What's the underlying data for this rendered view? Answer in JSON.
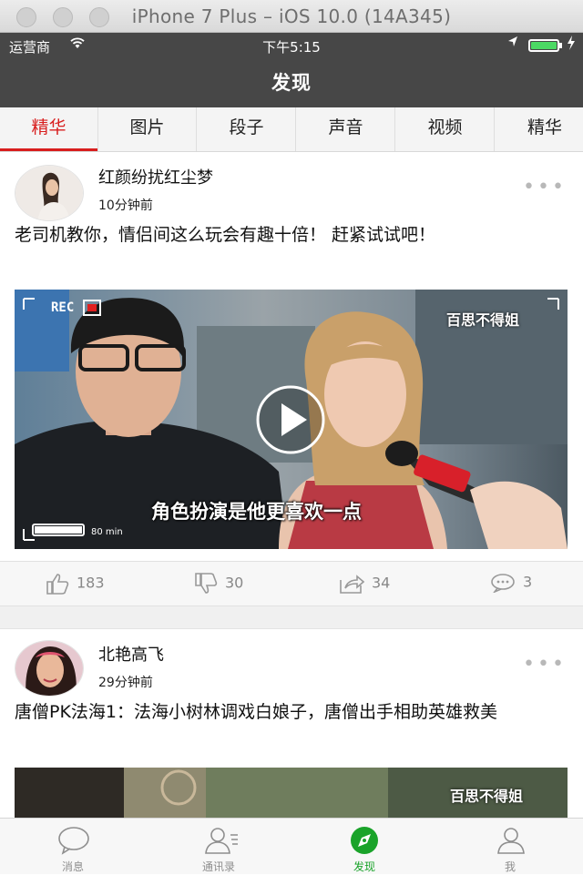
{
  "window": {
    "title": "iPhone 7 Plus – iOS 10.0 (14A345)"
  },
  "status_bar": {
    "carrier": "运营商",
    "time": "下午5:15"
  },
  "nav": {
    "title": "发现"
  },
  "tabs": [
    {
      "label": "精华",
      "active": true
    },
    {
      "label": "图片",
      "active": false
    },
    {
      "label": "段子",
      "active": false
    },
    {
      "label": "声音",
      "active": false
    },
    {
      "label": "视频",
      "active": false
    },
    {
      "label": "精华",
      "active": false
    }
  ],
  "posts": [
    {
      "author": "红颜纷扰红尘梦",
      "time": "10分钟前",
      "text": "老司机教你，情侣间这么玩会有趣十倍！ 赶紧试试吧！",
      "video": {
        "rec_label": "REC",
        "watermark": "百思不得姐",
        "caption": "角色扮演是他更喜欢一点",
        "duration_label": "80 min",
        "battery_level": 1.0
      },
      "actions": {
        "likes": "183",
        "dislikes": "30",
        "shares": "34",
        "comments": "3"
      }
    },
    {
      "author": "北艳高飞",
      "time": "29分钟前",
      "text": "唐僧PK法海1：法海小树林调戏白娘子，唐僧出手相助英雄救美",
      "video": {
        "watermark": "百思不得姐"
      }
    }
  ],
  "tabbar": [
    {
      "label": "消息",
      "icon": "chat-bubble-icon",
      "active": false
    },
    {
      "label": "通讯录",
      "icon": "contacts-icon",
      "active": false
    },
    {
      "label": "发现",
      "icon": "compass-icon",
      "active": true
    },
    {
      "label": "我",
      "icon": "person-icon",
      "active": false
    }
  ],
  "colors": {
    "accent": "#d81e1e",
    "navbar": "#474747",
    "tab_active": "#1aa32a"
  }
}
